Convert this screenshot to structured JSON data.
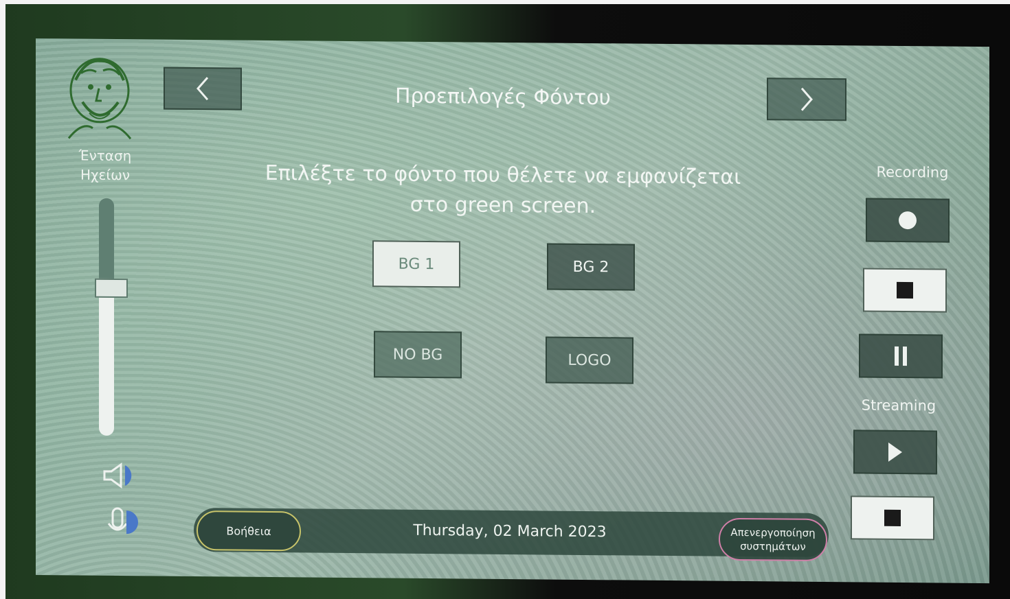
{
  "header": {
    "title": "Προεπιλογές Φόντου",
    "prev_icon": "chevron-left-icon",
    "next_icon": "chevron-right-icon"
  },
  "volume": {
    "title_line1": "Ένταση",
    "title_line2": "Ηχείων",
    "level": 0.62
  },
  "main": {
    "instruction_line1": "Επιλέξτε το φόντο που θέλετε να εμφανίζεται",
    "instruction_line2": "στο green screen.",
    "options": [
      {
        "label": "BG 1",
        "selected": true
      },
      {
        "label": "BG 2",
        "selected": false
      },
      {
        "label": "NO BG",
        "selected": false
      },
      {
        "label": "LOGO",
        "selected": false
      }
    ]
  },
  "recording": {
    "label": "Recording",
    "record_icon": "record-dot-icon",
    "stop_icon": "stop-icon",
    "pause_icon": "pause-icon"
  },
  "streaming": {
    "label": "Streaming",
    "play_icon": "play-icon",
    "stop_icon": "stop-icon"
  },
  "footer": {
    "help_label": "Βοήθεια",
    "date": "Thursday, 02 March 2023",
    "disable_line1": "Απενεργοποίηση",
    "disable_line2": "συστημάτων"
  },
  "colors": {
    "screen_tint": "#8fb3a1",
    "help_border": "#c8c46a",
    "disable_border": "#d07fa8",
    "logo_green": "#2f6b2f"
  }
}
